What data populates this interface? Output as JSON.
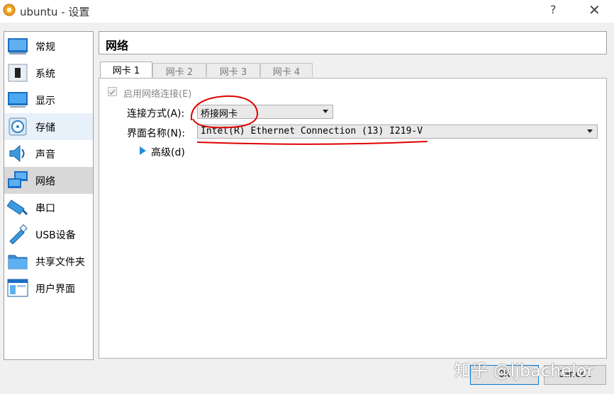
{
  "window": {
    "title": "ubuntu - 设置",
    "help": "?",
    "close": "✕"
  },
  "sidebar": {
    "items": [
      {
        "label": "常规",
        "icon": "general-icon"
      },
      {
        "label": "系统",
        "icon": "system-icon"
      },
      {
        "label": "显示",
        "icon": "display-icon"
      },
      {
        "label": "存储",
        "icon": "storage-icon"
      },
      {
        "label": "声音",
        "icon": "audio-icon"
      },
      {
        "label": "网络",
        "icon": "network-icon"
      },
      {
        "label": "串口",
        "icon": "serial-port-icon"
      },
      {
        "label": "USB设备",
        "icon": "usb-icon"
      },
      {
        "label": "共享文件夹",
        "icon": "shared-folder-icon"
      },
      {
        "label": "用户界面",
        "icon": "user-interface-icon"
      }
    ],
    "selected": "网络"
  },
  "page": {
    "title": "网络"
  },
  "tabs": [
    "网卡 1",
    "网卡 2",
    "网卡 3",
    "网卡 4"
  ],
  "adapter": {
    "enable_label": "启用网络连接(E)",
    "enabled": true,
    "attach_label": "连接方式(A):",
    "attach_value": "桥接网卡",
    "name_label": "界面名称(N):",
    "name_value": "Intel(R) Ethernet Connection (13) I219-V",
    "advanced_label": "高级(d)"
  },
  "buttons": {
    "ok": "OK",
    "cancel": "Cancel"
  },
  "watermark": "知乎 @ljbachelor",
  "colors": {
    "accent": "#1e8ee0",
    "annotation": "#e00000",
    "selected_bg": "#d8d8d8"
  }
}
